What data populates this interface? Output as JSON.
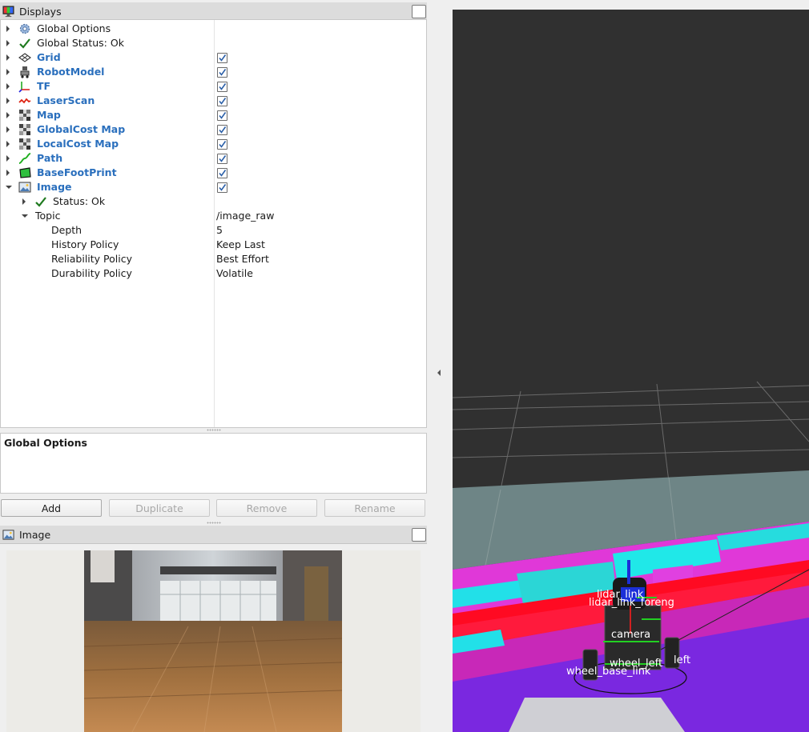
{
  "displays_panel": {
    "title": "Displays",
    "icon": "monitor-icon",
    "rows": [
      {
        "label": "Global Options",
        "icon": "gear-icon",
        "style": "normal"
      },
      {
        "label": "Global Status: Ok",
        "icon": "checkmark-icon",
        "style": "normal"
      },
      {
        "label": "Grid",
        "icon": "grid-icon",
        "style": "blue",
        "checked": true
      },
      {
        "label": "RobotModel",
        "icon": "robot-icon",
        "style": "blue",
        "checked": true
      },
      {
        "label": "TF",
        "icon": "axes-icon",
        "style": "blue",
        "checked": true
      },
      {
        "label": "LaserScan",
        "icon": "laser-icon",
        "style": "blue",
        "checked": true
      },
      {
        "label": "Map",
        "icon": "map-icon",
        "style": "blue",
        "checked": true
      },
      {
        "label": "GlobalCost Map",
        "icon": "map-icon",
        "style": "blue",
        "checked": true
      },
      {
        "label": "LocalCost Map",
        "icon": "map-icon",
        "style": "blue",
        "checked": true
      },
      {
        "label": "Path",
        "icon": "path-icon",
        "style": "blue",
        "checked": true
      },
      {
        "label": "BaseFootPrint",
        "icon": "polygon-icon",
        "style": "blue",
        "checked": true
      },
      {
        "label": "Image",
        "icon": "image-icon",
        "style": "blue",
        "checked": true,
        "expanded": true
      }
    ],
    "image_children": {
      "status": "Status: Ok",
      "topic_label": "Topic",
      "topic_value": "/image_raw",
      "properties": [
        {
          "label": "Depth",
          "value": "5"
        },
        {
          "label": "History Policy",
          "value": "Keep Last"
        },
        {
          "label": "Reliability Policy",
          "value": "Best Effort"
        },
        {
          "label": "Durability Policy",
          "value": "Volatile"
        }
      ]
    }
  },
  "description": {
    "title": "Global Options"
  },
  "buttons": {
    "add": "Add",
    "duplicate": "Duplicate",
    "remove": "Remove",
    "rename": "Rename"
  },
  "image_panel": {
    "title": "Image",
    "icon": "image-icon"
  },
  "view3d": {
    "frame_labels": [
      "lidar_link",
      "lidar_link_foreng",
      "camera",
      "wheel_left",
      "wheel_base_link",
      "left"
    ]
  },
  "colors": {
    "accent_blue": "#2a6fbd",
    "costmap_magenta": "#e040e0",
    "costmap_cyan": "#20e8e8",
    "costmap_red": "#ff1030",
    "view_bg": "#303030"
  }
}
